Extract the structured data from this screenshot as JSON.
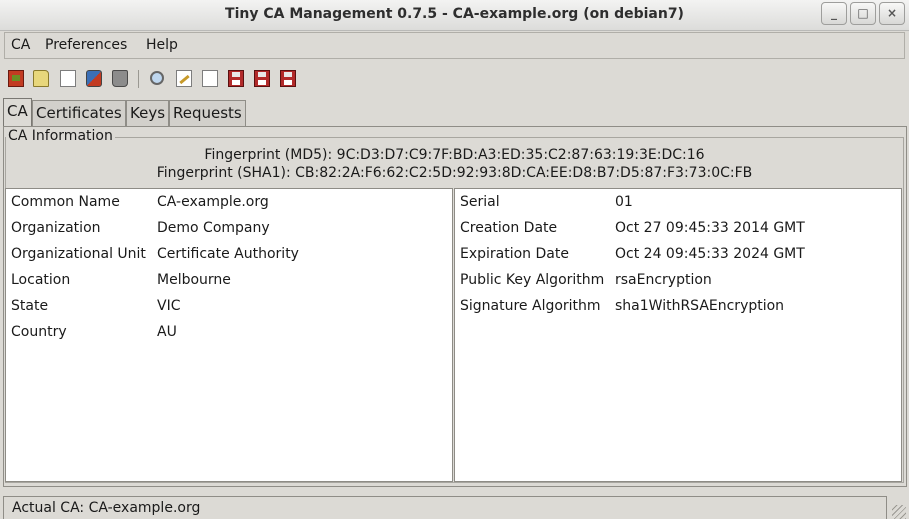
{
  "window": {
    "title": "Tiny CA Management 0.7.5 - CA-example.org (on debian7)",
    "buttons": {
      "minimize": "_",
      "maximize": "□",
      "close": "×"
    }
  },
  "menu": [
    "CA",
    "Preferences",
    "Help"
  ],
  "toolbar": [
    {
      "icon": "exit-icon"
    },
    {
      "icon": "open-folder-icon"
    },
    {
      "icon": "new-document-icon"
    },
    {
      "icon": "renew-icon"
    },
    {
      "icon": "trash-icon"
    },
    {
      "icon": "search-icon"
    },
    {
      "icon": "edit-icon"
    },
    {
      "icon": "blank-document-icon"
    },
    {
      "icon": "save-icon"
    },
    {
      "icon": "save-icon"
    },
    {
      "icon": "save-icon"
    }
  ],
  "tabs": [
    "CA",
    "Certificates",
    "Keys",
    "Requests"
  ],
  "ca_info": {
    "group_label": "CA Information",
    "fingerprint_md5": "Fingerprint (MD5): 9C:D3:D7:C9:7F:BD:A3:ED:35:C2:87:63:19:3E:DC:16",
    "fingerprint_sha1": "Fingerprint (SHA1): CB:82:2A:F6:62:C2:5D:92:93:8D:CA:EE:D8:B7:D5:87:F3:73:0C:FB",
    "left": [
      {
        "label": "Common Name",
        "value": "CA-example.org"
      },
      {
        "label": "Organization",
        "value": "Demo Company"
      },
      {
        "label": "Organizational Unit",
        "value": "Certificate Authority"
      },
      {
        "label": "Location",
        "value": "Melbourne"
      },
      {
        "label": "State",
        "value": "VIC"
      },
      {
        "label": "Country",
        "value": "AU"
      }
    ],
    "right": [
      {
        "label": "Serial",
        "value": "01"
      },
      {
        "label": "Creation Date",
        "value": "Oct 27 09:45:33 2014 GMT"
      },
      {
        "label": "Expiration Date",
        "value": "Oct 24 09:45:33 2024 GMT"
      },
      {
        "label": "Public Key Algorithm",
        "value": "rsaEncryption"
      },
      {
        "label": "Signature Algorithm",
        "value": "sha1WithRSAEncryption"
      }
    ]
  },
  "status": "Actual CA: CA-example.org"
}
